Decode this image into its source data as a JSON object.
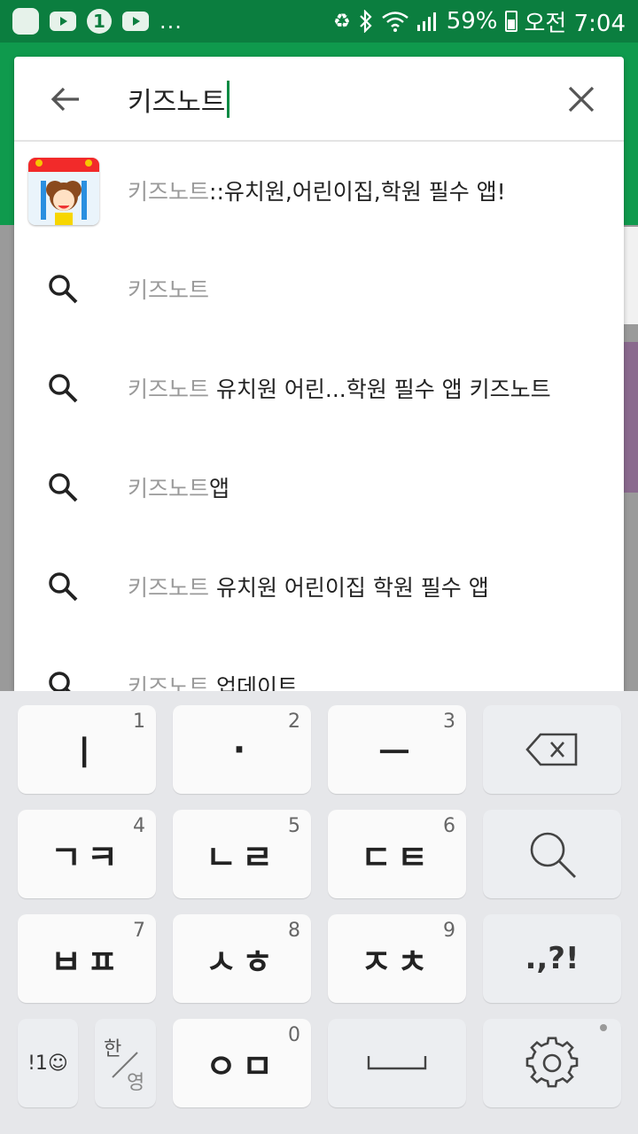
{
  "status_bar": {
    "battery_percent": "59%",
    "time": "오전 7:04",
    "left_icons": [
      "app-icon",
      "youtube-icon",
      "number-one-icon",
      "youtube-icon",
      "more-dots"
    ],
    "more": "...",
    "right_icons": [
      "recycle-icon",
      "bluetooth-icon",
      "wifi-icon",
      "signal-icon",
      "battery-icon"
    ]
  },
  "search": {
    "query": "키즈노트",
    "back_icon": "arrow-left-icon",
    "clear_icon": "close-icon"
  },
  "suggestions": {
    "app": {
      "prefix": "키즈노트",
      "rest": "::유치원,어린이집,학원 필수 앱!"
    },
    "items": [
      {
        "prefix": "키즈노트",
        "rest": ""
      },
      {
        "prefix": "키즈노트",
        "rest": " 유치원 어린...학원 필수 앱 키즈노트"
      },
      {
        "prefix": "키즈노트",
        "rest": "앱"
      },
      {
        "prefix": "키즈노트",
        "rest": " 유치원 어린이집 학원 필수 앱"
      },
      {
        "prefix": "키즈노트",
        "rest": " 업데이트"
      }
    ]
  },
  "keyboard": {
    "row1": [
      {
        "label": "ㅣ",
        "num": "1"
      },
      {
        "label": "·",
        "num": "2"
      },
      {
        "label": "ㅡ",
        "num": "3"
      }
    ],
    "row2": [
      {
        "label": "ㄱㅋ",
        "num": "4"
      },
      {
        "label": "ㄴㄹ",
        "num": "5"
      },
      {
        "label": "ㄷㅌ",
        "num": "6"
      }
    ],
    "row3": [
      {
        "label": "ㅂㅍ",
        "num": "7"
      },
      {
        "label": "ㅅㅎ",
        "num": "8"
      },
      {
        "label": "ㅈㅊ",
        "num": "9"
      }
    ],
    "punct": ".,?!",
    "symbols": "!1☺",
    "lang_top": "한",
    "lang_bottom": "영",
    "row4_main": {
      "label": "ㅇㅁ",
      "num": "0"
    }
  },
  "colors": {
    "status_bar": "#0b7e3f",
    "accent": "#0b8a43",
    "query_gray": "#9a9a9a",
    "keyboard_bg": "#e6e7ea"
  }
}
